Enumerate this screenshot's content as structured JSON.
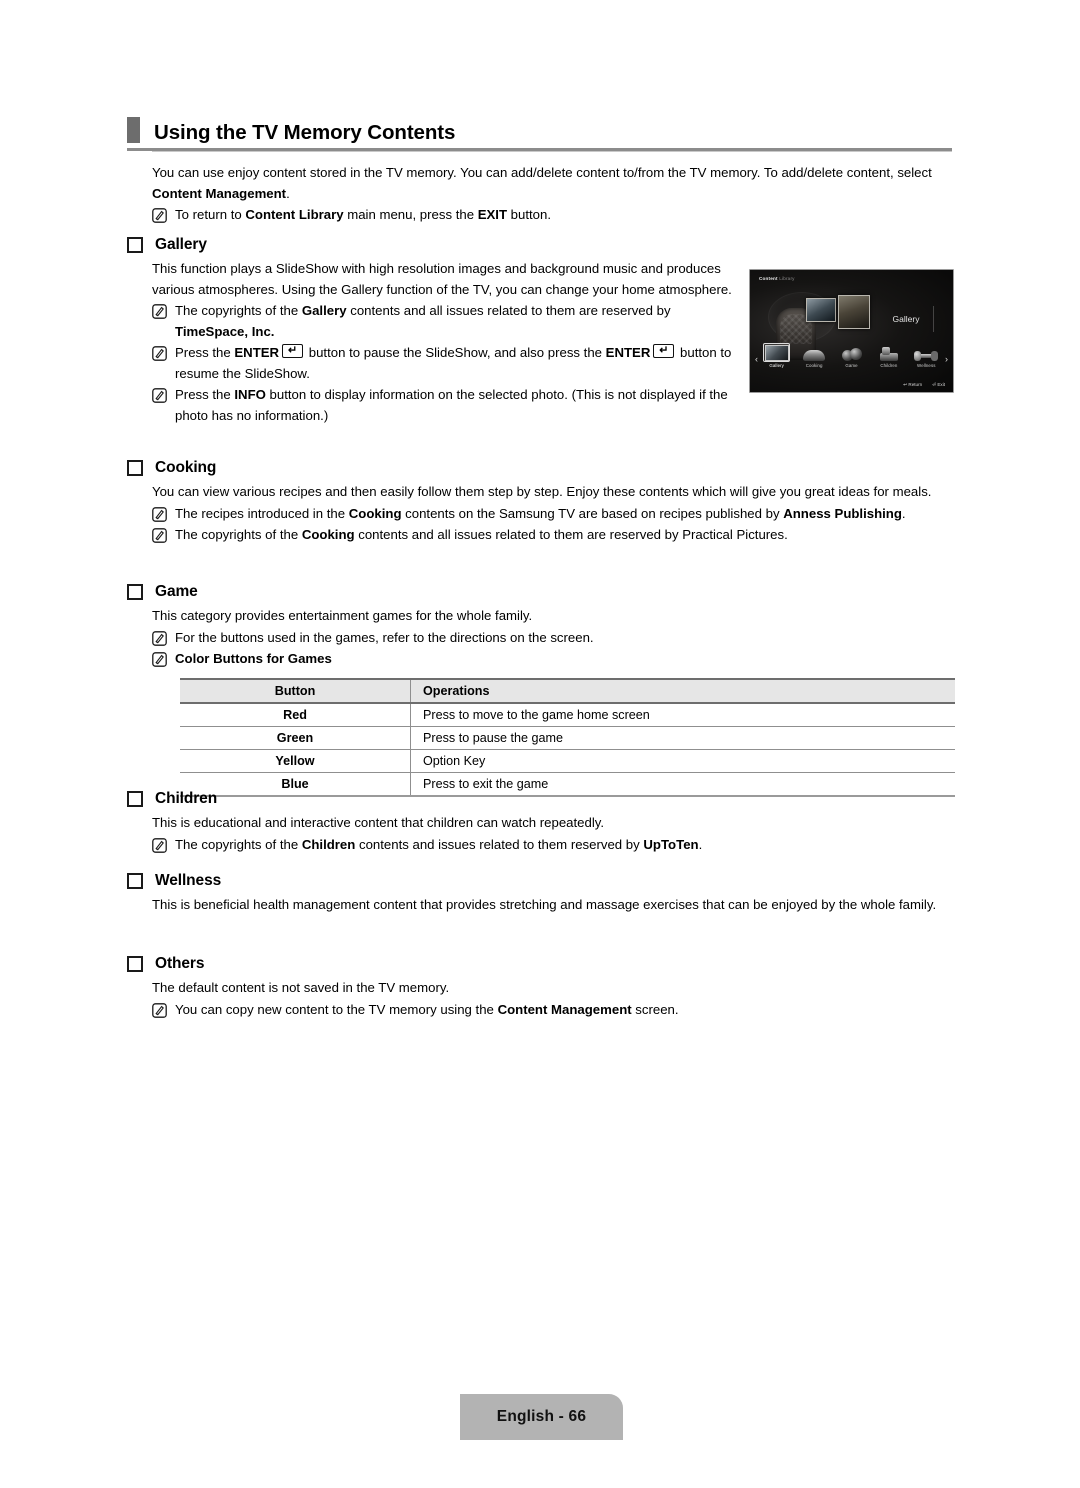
{
  "header": {
    "title": "Using the TV Memory Contents"
  },
  "intro": {
    "line1_a": "You can use enjoy content stored in the TV memory. You can add/delete content to/from the TV memory. To add/delete content,",
    "line2_a": "select ",
    "line2_b": "Content Management",
    "line2_c": ".",
    "note_a": "To return to ",
    "note_b": "Content Library",
    "note_c": " main menu, press the ",
    "note_d": "EXIT",
    "note_e": " button."
  },
  "sections": {
    "gallery": {
      "title": "Gallery",
      "body": "This function plays a SlideShow with high resolution images and background music and produces various atmospheres. Using the Gallery function of the TV, you can change your home atmosphere.",
      "note1_a": "The copyrights of the ",
      "note1_b": "Gallery",
      "note1_c": " contents and all issues related to them are reserved by ",
      "note1_d": "TimeSpace, Inc.",
      "note2_a": "Press the ",
      "note2_b": "ENTER",
      "note2_c": " button to pause the SlideShow, and also press the ",
      "note2_d": "ENTER",
      "note2_e": " button to resume the SlideShow.",
      "note3_a": "Press the ",
      "note3_b": "INFO",
      "note3_c": " button to display information on the selected photo. (This is not displayed if the photo has no information.)"
    },
    "cooking": {
      "title": "Cooking",
      "body": "You can view various recipes and then easily follow them step by step. Enjoy these contents which will give you great ideas for meals.",
      "note1_a": "The recipes introduced in the ",
      "note1_b": "Cooking",
      "note1_c": " contents on the Samsung TV are based on recipes published by ",
      "note1_d": "Anness Publishing",
      "note1_e": ".",
      "note2_a": "The copyrights of the ",
      "note2_b": "Cooking",
      "note2_c": " contents and all issues related to them are reserved by Practical Pictures."
    },
    "game": {
      "title": "Game",
      "body": "This category provides entertainment games for the whole family.",
      "note1": "For the buttons used in the games, refer to the directions on the screen.",
      "note2": "Color Buttons for Games"
    },
    "children": {
      "title": "Children",
      "body": "This is educational and interactive content that children can watch repeatedly.",
      "note1_a": "The copyrights of the ",
      "note1_b": "Children",
      "note1_c": " contents and issues related to them reserved by ",
      "note1_d": "UpToTen",
      "note1_e": "."
    },
    "wellness": {
      "title": "Wellness",
      "body": "This is beneficial health management content that provides stretching and massage exercises that can be enjoyed by the whole family."
    },
    "others": {
      "title": "Others",
      "body": "The default content is not saved in the TV memory.",
      "note1_a": "You can copy new content to the TV memory using the ",
      "note1_b": "Content Management",
      "note1_c": " screen."
    }
  },
  "table": {
    "headers": [
      "Button",
      "Operations"
    ],
    "rows": [
      {
        "button": "Red",
        "operation": "Press to move to the game home screen"
      },
      {
        "button": "Green",
        "operation": "Press to pause the game"
      },
      {
        "button": "Yellow",
        "operation": "Option Key"
      },
      {
        "button": "Blue",
        "operation": "Press to exit the game"
      }
    ]
  },
  "tv_screen": {
    "title_bold": "Content",
    "title_light": " Library",
    "selected_label": "Gallery",
    "nav": [
      {
        "label": "Gallery",
        "icon": "gallery-thumb-icon"
      },
      {
        "label": "Cooking",
        "icon": "cooking-thumb-icon"
      },
      {
        "label": "Game",
        "icon": "game-thumb-icon"
      },
      {
        "label": "Children",
        "icon": "children-thumb-icon"
      },
      {
        "label": "Wellness",
        "icon": "wellness-thumb-icon"
      }
    ],
    "arrow_left": "‹",
    "arrow_right": "›",
    "return_key": "↩",
    "return_label": "Return",
    "exit_key": "⏎",
    "exit_label": "Exit"
  },
  "footer": {
    "page_label": "English - 66"
  }
}
